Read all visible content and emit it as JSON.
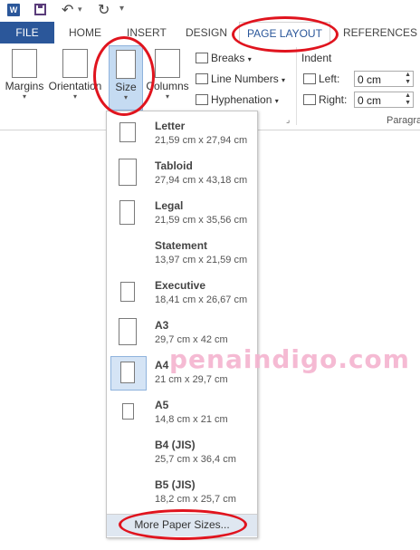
{
  "quick_access": {
    "app_icon": "W",
    "icons": [
      "save-icon",
      "undo-icon",
      "redo-icon",
      "customize-qat-icon"
    ]
  },
  "tabs": [
    {
      "label": "FILE"
    },
    {
      "label": "HOME"
    },
    {
      "label": "INSERT"
    },
    {
      "label": "DESIGN"
    },
    {
      "label": "PAGE LAYOUT"
    },
    {
      "label": "REFERENCES"
    }
  ],
  "ribbon": {
    "margins": "Margins",
    "orientation": "Orientation",
    "size": "Size",
    "columns": "Columns",
    "breaks": "Breaks",
    "line_numbers": "Line Numbers",
    "hyphenation": "Hyphenation",
    "indent_label": "Indent",
    "left_label": "Left:",
    "right_label": "Right:",
    "left_value": "0 cm",
    "right_value": "0 cm",
    "paragraph_group": "Paragra"
  },
  "paper_sizes": [
    {
      "name": "Letter",
      "dims": "21,59 cm x 27,94 cm"
    },
    {
      "name": "Tabloid",
      "dims": "27,94 cm x 43,18 cm"
    },
    {
      "name": "Legal",
      "dims": "21,59 cm x 35,56 cm"
    },
    {
      "name": "Statement",
      "dims": "13,97 cm x 21,59 cm"
    },
    {
      "name": "Executive",
      "dims": "18,41 cm x 26,67 cm"
    },
    {
      "name": "A3",
      "dims": "29,7 cm x 42 cm"
    },
    {
      "name": "A4",
      "dims": "21 cm x 29,7 cm"
    },
    {
      "name": "A5",
      "dims": "14,8 cm x 21 cm"
    },
    {
      "name": "B4 (JIS)",
      "dims": "25,7 cm x 36,4 cm"
    },
    {
      "name": "B5 (JIS)",
      "dims": "18,2 cm x 25,7 cm"
    }
  ],
  "more_sizes": "More Paper Sizes...",
  "watermark": "penaindigo.com",
  "colors": {
    "accent": "#2b579a",
    "annotation": "#e0141e"
  }
}
